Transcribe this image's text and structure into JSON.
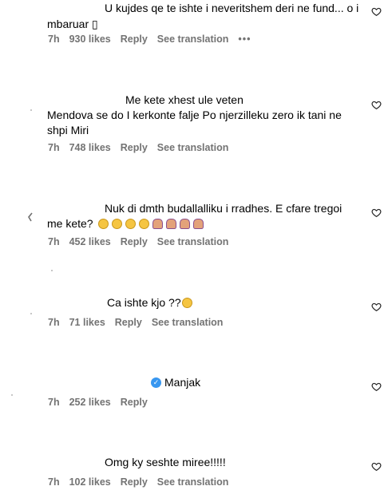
{
  "comments": [
    {
      "line1": "U kujdes qe te ishte i neveritshem deri ne fund... o i",
      "line2": "mbaruar ▯",
      "time": "7h",
      "likes": "930 likes",
      "reply": "Reply",
      "translation": "See translation",
      "more": "•••"
    },
    {
      "line1": "Me kete xhest ule veten",
      "line2": "Mendova se do I kerkonte falje Po njerzilleku zero ik tani ne",
      "line3": "shpi Miri",
      "time": "7h",
      "likes": "748 likes",
      "reply": "Reply",
      "translation": "See translation"
    },
    {
      "line1": "Nuk di dmth budallalliku i rradhes. E cfare tregoi",
      "line2": "me kete?",
      "time": "7h",
      "likes": "452 likes",
      "reply": "Reply",
      "translation": "See translation"
    },
    {
      "line1": "Ca ishte kjo ??",
      "time": "7h",
      "likes": "71 likes",
      "reply": "Reply",
      "translation": "See translation"
    },
    {
      "line1": "Manjak",
      "time": "7h",
      "likes": "252 likes",
      "reply": "Reply"
    },
    {
      "line1": "Omg ky seshte miree!!!!!",
      "time": "7h",
      "likes": "102 likes",
      "reply": "Reply",
      "translation": "See translation"
    }
  ],
  "icons": {
    "like": "heart-outline-icon",
    "verified": "verified-badge-icon"
  },
  "colors": {
    "meta": "#737373",
    "verified": "#3897f0"
  }
}
